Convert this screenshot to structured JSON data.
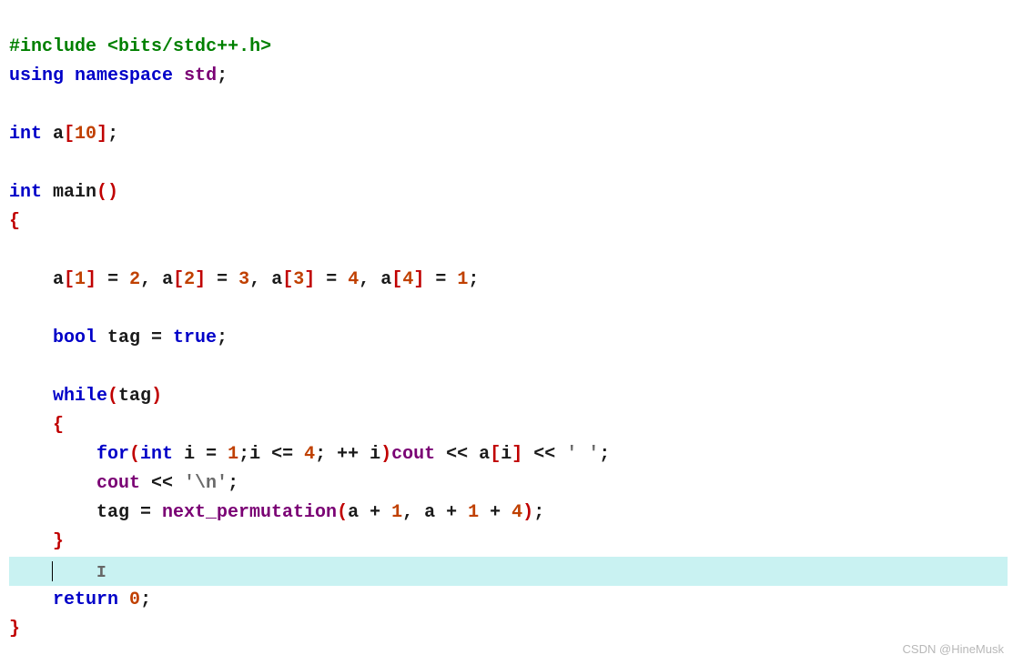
{
  "code": {
    "line1_include": "#include",
    "line1_angle_open": "<",
    "line1_header": "bits/stdc++.h",
    "line1_angle_close": ">",
    "line2_using": "using",
    "line2_namespace": "namespace",
    "line2_std": "std",
    "line4_int": "int",
    "line4_ident": " a",
    "line4_num": "10",
    "line6_int": "int",
    "line6_main": " main",
    "line9_a": "    a",
    "line9_n1": "1",
    "line9_eq1": " = ",
    "line9_v1": "2",
    "line9_c1": ", a",
    "line9_n2": "2",
    "line9_eq2": " = ",
    "line9_v2": "3",
    "line9_c2": ", a",
    "line9_n3": "3",
    "line9_eq3": " = ",
    "line9_v3": "4",
    "line9_c3": ", a",
    "line9_n4": "4",
    "line9_eq4": " = ",
    "line9_v4": "1",
    "line11_bool": "    bool",
    "line11_tag": " tag = ",
    "line11_true": "true",
    "line13_while": "    while",
    "line13_tag": "tag",
    "line15_for": "        for",
    "line15_int": "int",
    "line15_i": " i = ",
    "line15_n1": "1",
    "line15_cond": ";i <= ",
    "line15_n2": "4",
    "line15_inc": "; ++ i",
    "line15_cout": "cout",
    "line15_shift1": " << a",
    "line15_idx": "i",
    "line15_shift2": " << ",
    "line15_sp": "' '",
    "line16_indent": "        ",
    "line16_cout": "cout",
    "line16_shift": " << ",
    "line16_nl": "'\\n'",
    "line17_indent": "        tag = ",
    "line17_np": "next_permutation",
    "line17_arg1": "a + ",
    "line17_n1": "1",
    "line17_arg2": ", a + ",
    "line17_n2": "1",
    "line17_arg3": " + ",
    "line17_n3": "4",
    "line20_return": "    return",
    "line20_zero": "0"
  },
  "punct": {
    "semi": ";",
    "lbracket": "[",
    "rbracket": "]",
    "lparen": "(",
    "rparen": ")",
    "lbrace": "{",
    "rbrace": "}"
  },
  "watermark": "CSDN @HineMusk"
}
